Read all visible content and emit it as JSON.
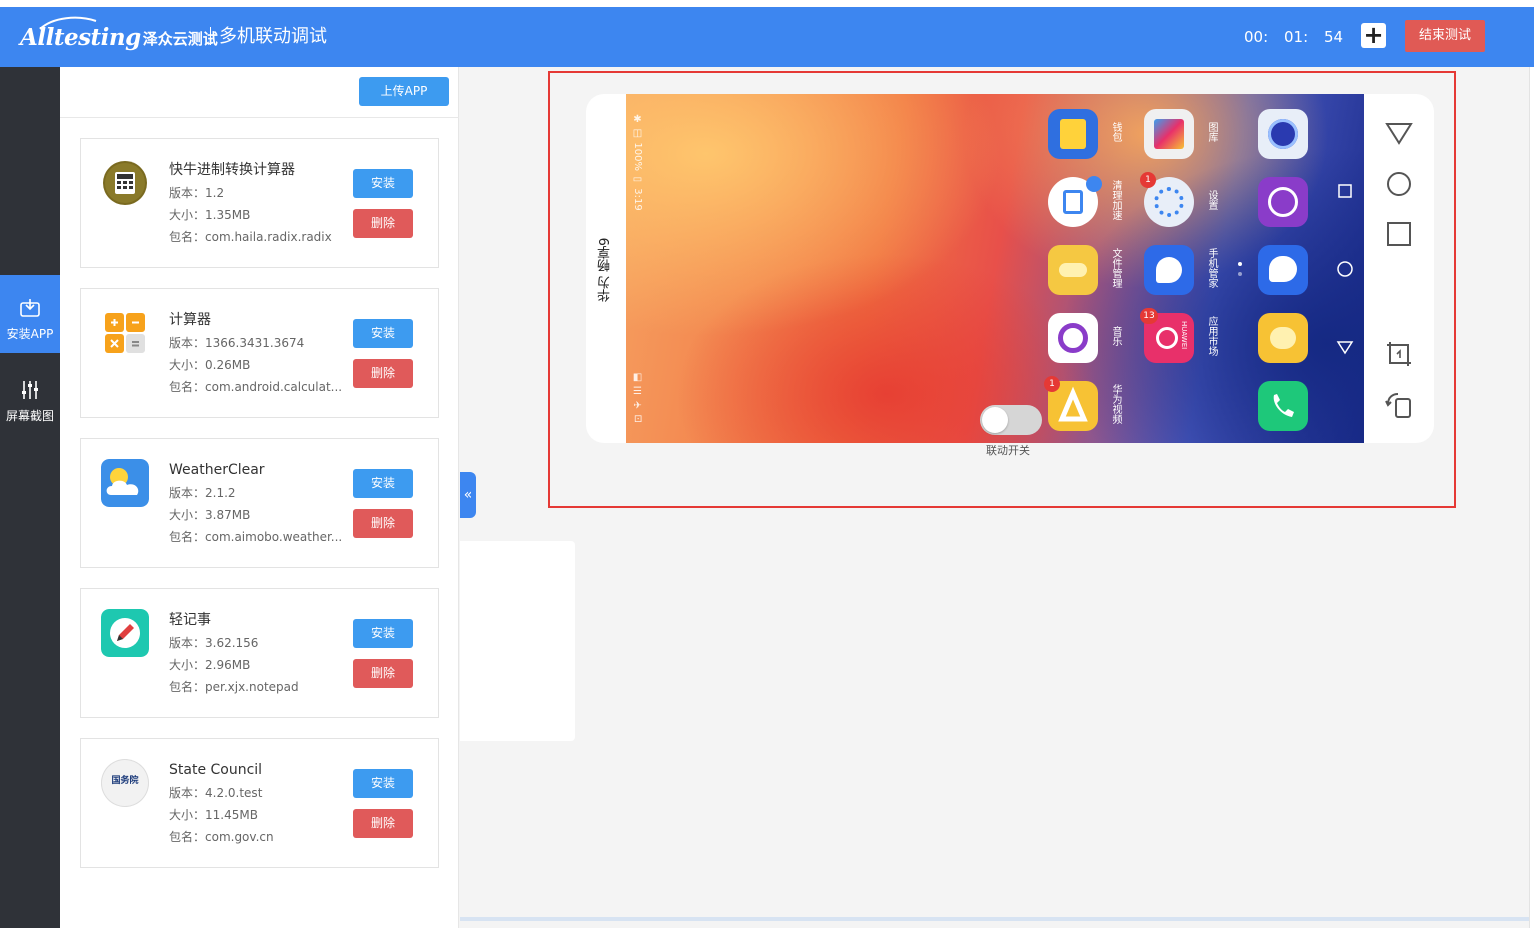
{
  "header": {
    "logo_en": "Alltesting",
    "logo_cn": "泽众云测试",
    "title": "多机联动调试",
    "timer": {
      "h": "00:",
      "m": "01:",
      "s": "54"
    },
    "add_label": "+",
    "end_label": "结束测试",
    "bg_color": "#3d86f0"
  },
  "sidebar": {
    "items": [
      {
        "label": "安装APP",
        "icon": "install-icon",
        "active": true
      },
      {
        "label": "屏幕截图",
        "icon": "sliders-icon",
        "active": false
      }
    ]
  },
  "panel": {
    "upload_label": "上传APP",
    "install_label": "安装",
    "delete_label": "删除",
    "apps": [
      {
        "name": "快牛进制转换计算器",
        "version": "版本：1.2",
        "size": "大小：1.35MB",
        "package": "包名：com.haila.radix.radix",
        "icon": "calculator-dark-icon"
      },
      {
        "name": "计算器",
        "version": "版本：1366.3431.3674",
        "size": "大小：0.26MB",
        "package": "包名：com.android.calculat...",
        "icon": "calculator-orange-icon"
      },
      {
        "name": "WeatherClear",
        "version": "版本：2.1.2",
        "size": "大小：3.87MB",
        "package": "包名：com.aimobo.weather...",
        "icon": "weather-cloud-icon"
      },
      {
        "name": "轻记事",
        "version": "版本：3.62.156",
        "size": "大小：2.96MB",
        "package": "包名：per.xjx.notepad",
        "icon": "notepad-pencil-icon"
      },
      {
        "name": "State Council",
        "version": "版本：4.2.0.test",
        "size": "大小：11.45MB",
        "package": "包名：com.gov.cn",
        "icon": "state-council-icon"
      }
    ]
  },
  "device": {
    "label": "华为 畅享9",
    "statusbar": "✱ ◫ 100% ▭ 3:19",
    "statusbar_bottom": "◧ ☰ ✈ ⊡",
    "tiles": [
      {
        "label": "钱包",
        "color": "#2f6fe0"
      },
      {
        "label": "清理加速",
        "color": "#ffffff"
      },
      {
        "label": "文件管理",
        "color": "#f5c842"
      },
      {
        "label": "音乐",
        "color": "#ffffff"
      },
      {
        "label": "华为视频",
        "color": "#f7c234"
      },
      {
        "label": "图库",
        "color": "#f0f0f0"
      },
      {
        "label": "设置",
        "color": "#e8eef8"
      },
      {
        "label": "手机管家",
        "color": "#2d6ae8"
      },
      {
        "label": "应用市场",
        "color": "#e8306a"
      }
    ],
    "badges": [
      "1",
      "1",
      "13"
    ],
    "logo_small": "HUAWEI",
    "toggle_label": "联动开关",
    "council_mark": "国务院"
  }
}
